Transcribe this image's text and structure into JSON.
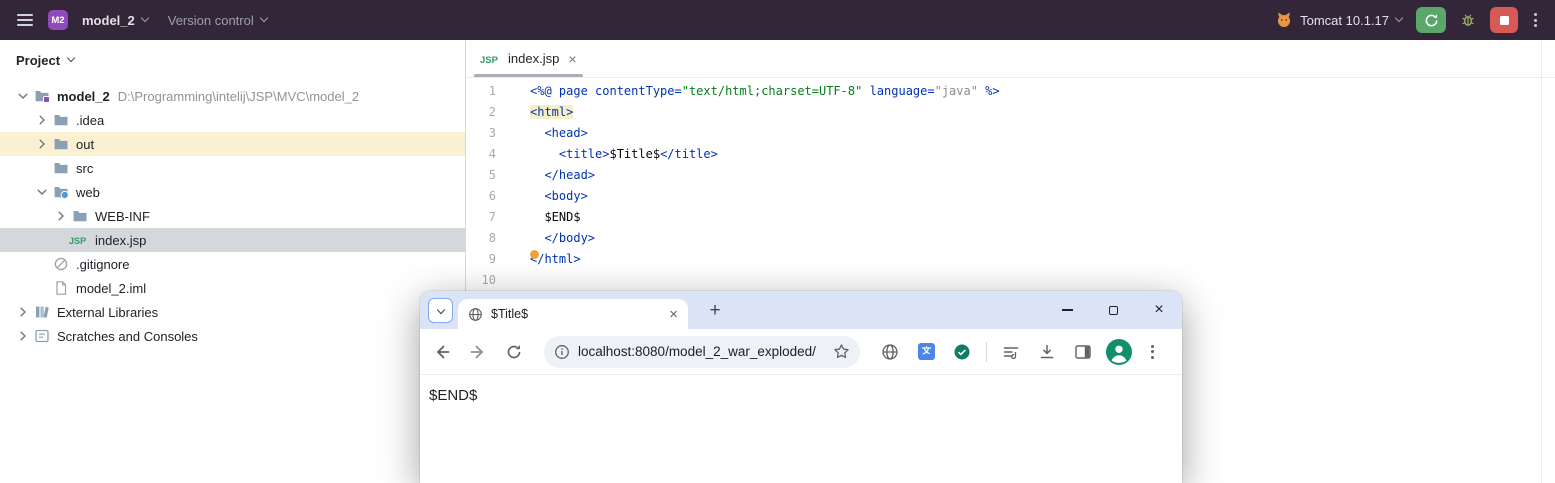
{
  "titlebar": {
    "project_badge": "M2",
    "project_name": "model_2",
    "version_control_label": "Version control",
    "run_config_label": "Tomcat 10.1.17"
  },
  "project_panel": {
    "header_label": "Project",
    "tree": [
      {
        "level": 0,
        "chevron": "down",
        "icon": "project-folder",
        "label": "model_2",
        "path_suffix": "D:\\Programming\\intelij\\JSP\\MVC\\model_2",
        "bold": true
      },
      {
        "level": 1,
        "chevron": "right",
        "icon": "folder",
        "label": ".idea"
      },
      {
        "level": 1,
        "chevron": "right",
        "icon": "folder",
        "label": "out",
        "row_highlight": "#faf1d2"
      },
      {
        "level": 1,
        "chevron": "none",
        "icon": "folder",
        "label": "src"
      },
      {
        "level": 1,
        "chevron": "down",
        "icon": "web-folder",
        "label": "web"
      },
      {
        "level": 2,
        "chevron": "right",
        "icon": "folder",
        "label": "WEB-INF"
      },
      {
        "level": 2,
        "chevron": "none",
        "icon": "jsp-file",
        "label": "index.jsp",
        "selected": true
      },
      {
        "level": 1,
        "chevron": "none",
        "icon": "ignored-file",
        "label": ".gitignore"
      },
      {
        "level": 1,
        "chevron": "none",
        "icon": "iml-file",
        "label": "model_2.iml"
      },
      {
        "level": 0,
        "chevron": "right",
        "icon": "external-libraries",
        "label": "External Libraries"
      },
      {
        "level": 0,
        "chevron": "right",
        "icon": "scratches",
        "label": "Scratches and Consoles"
      }
    ]
  },
  "editor": {
    "tab_label": "index.jsp",
    "file_type_badge": "JSP",
    "lines": [
      [
        [
          "t",
          "<%@ page contentType="
        ],
        [
          "s",
          "\"text/html;charset=UTF-8\""
        ],
        [
          "t",
          " language="
        ],
        [
          "g",
          "\"java\""
        ],
        [
          "t",
          " %>"
        ]
      ],
      [
        [
          "th",
          "<html>"
        ]
      ],
      [
        [
          "k",
          "  "
        ],
        [
          "t",
          "<head>"
        ]
      ],
      [
        [
          "k",
          "    "
        ],
        [
          "t",
          "<title>"
        ],
        [
          "k",
          "$Title$"
        ],
        [
          "t",
          "</title>"
        ]
      ],
      [
        [
          "k",
          "  "
        ],
        [
          "t",
          "</head>"
        ]
      ],
      [
        [
          "k",
          "  "
        ],
        [
          "t",
          "<body>"
        ]
      ],
      [
        [
          "k",
          "  $END$"
        ]
      ],
      [
        [
          "k",
          "  "
        ],
        [
          "t",
          "</body>"
        ]
      ],
      [
        [
          "t",
          "</html>"
        ]
      ],
      []
    ]
  },
  "browser": {
    "tab_title": "$Title$",
    "url": "localhost:8080/model_2_war_exploded/",
    "page_text": "$END$"
  },
  "glyphs": {
    "close": "×",
    "plus": "+"
  },
  "colors": {
    "titlebar_bg": "#342639",
    "project_badge_purple": "#8f4bbd",
    "run_green": "#59a869",
    "stop_red": "#d75a56",
    "selected_row_gray": "#d4d7db",
    "highlighted_row_yellow": "#faf1d2",
    "tag_blue": "#0033b3",
    "string_green": "#067d17",
    "browser_tabstrip_blue": "#dae4f6",
    "avatar_green": "#0f8f6c",
    "inline_dot_orange": "#eca33b"
  }
}
